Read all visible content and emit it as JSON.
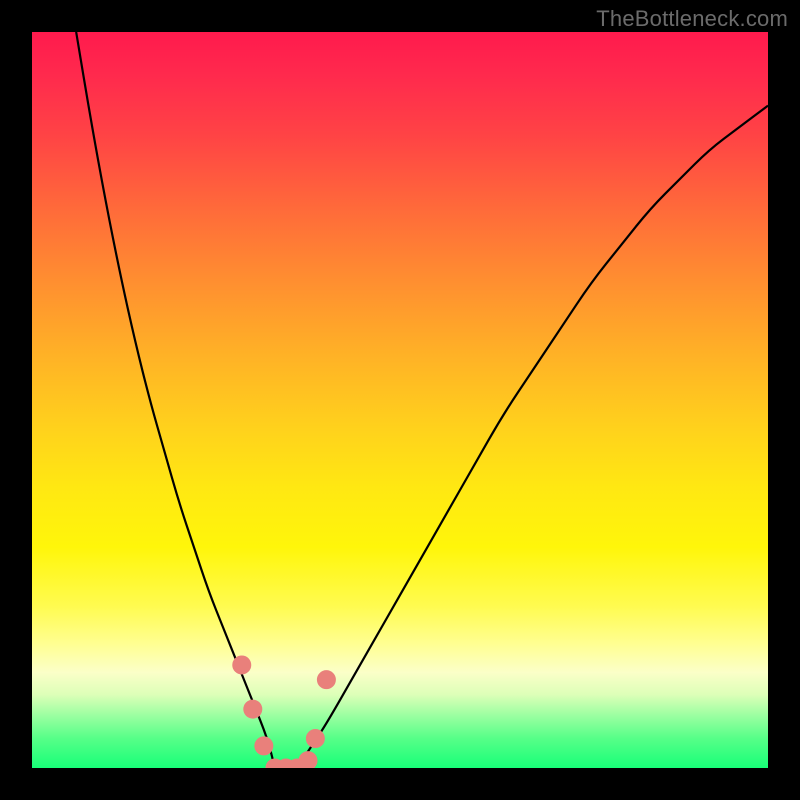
{
  "watermark": "TheBottleneck.com",
  "colors": {
    "curve_stroke": "#000000",
    "marker_fill": "#e9807b",
    "marker_stroke": "#d66a66"
  },
  "chart_data": {
    "type": "line",
    "title": "",
    "xlabel": "",
    "ylabel": "",
    "xlim": [
      0,
      100
    ],
    "ylim": [
      0,
      100
    ],
    "series": [
      {
        "name": "left-branch",
        "x": [
          6,
          8,
          10,
          12,
          14,
          16,
          18,
          20,
          22,
          24,
          26,
          28,
          30,
          32,
          33
        ],
        "y": [
          100,
          88,
          77,
          67,
          58,
          50,
          43,
          36,
          30,
          24,
          19,
          14,
          9,
          4,
          0
        ]
      },
      {
        "name": "right-branch",
        "x": [
          36,
          38,
          40,
          44,
          48,
          52,
          56,
          60,
          64,
          68,
          72,
          76,
          80,
          84,
          88,
          92,
          96,
          100
        ],
        "y": [
          0,
          3,
          6,
          13,
          20,
          27,
          34,
          41,
          48,
          54,
          60,
          66,
          71,
          76,
          80,
          84,
          87,
          90
        ]
      }
    ],
    "markers": {
      "name": "bottom-markers",
      "x": [
        28.5,
        30,
        31.5,
        33,
        34.5,
        36,
        37.5,
        38.5,
        40
      ],
      "y": [
        14,
        8,
        3,
        0,
        0,
        0,
        1,
        4,
        12
      ]
    }
  }
}
